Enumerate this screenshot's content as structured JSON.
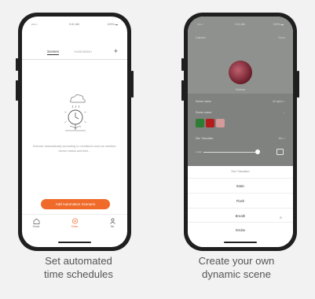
{
  "left": {
    "status": {
      "carrier": "•••• ≈",
      "time": "9:41 AM",
      "battery": "100% ▬"
    },
    "tabs": {
      "scenes": "Scenes",
      "automation": "Automation",
      "add": "+"
    },
    "empty_text": "Execute automatically according to conditions such as weather, device status and time...",
    "add_button": "Add Automation Scenario",
    "nav": {
      "home": "Home",
      "smart": "Smart",
      "me": "Me"
    },
    "caption": [
      "Set automated",
      "time schedules"
    ]
  },
  "right": {
    "header": {
      "cancel": "Cancel",
      "save": "Save"
    },
    "avatar_name": "Scenes",
    "rows": {
      "scene_name": "Scene name",
      "scene_name_value": "All lights >",
      "scene_colors": "Scene colors",
      "brightness": "Dim Transition",
      "brightness_value": "30s >",
      "low": "Lower"
    },
    "swatch_colors": [
      "#2e7d32",
      "#b71c1c",
      "#d59a9a"
    ],
    "sheet": {
      "title": "Dim Transition",
      "options": [
        "Static",
        "Flash",
        "Breath",
        "Strobe"
      ],
      "selected": "Breath",
      "check": "⊙"
    },
    "caption": [
      "Create your own",
      "dynamic scene"
    ]
  },
  "colors": {
    "accent": "#f06a2a",
    "phone": "#1f1f1f"
  }
}
